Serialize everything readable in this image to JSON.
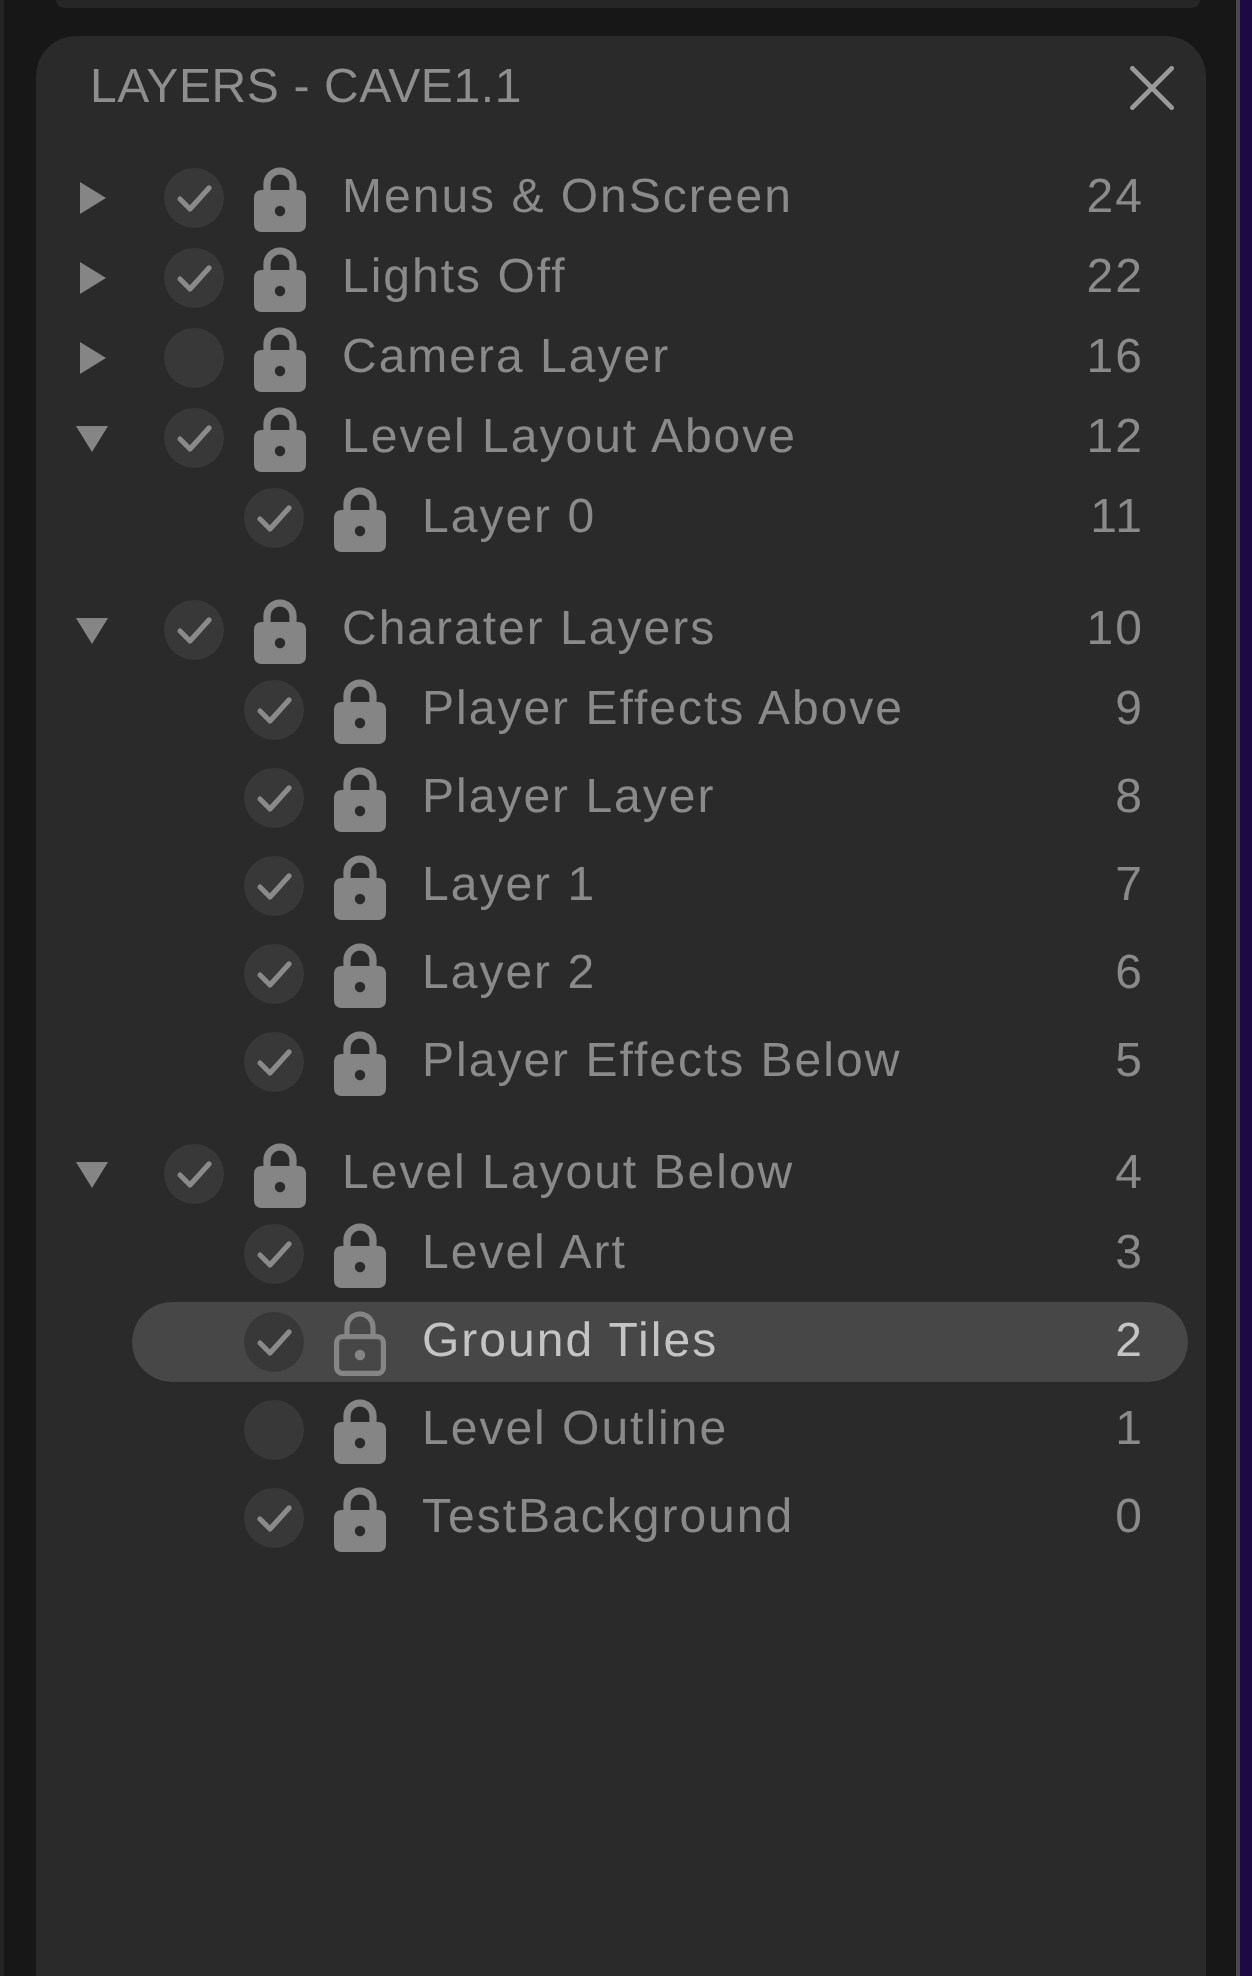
{
  "panel": {
    "title": "LAYERS - CAVE1.1"
  },
  "layers": [
    {
      "name": "Menus & OnScreen",
      "count": "24",
      "expanded": false,
      "visible": true,
      "locked": true,
      "selected": false
    },
    {
      "name": "Lights Off",
      "count": "22",
      "expanded": false,
      "visible": true,
      "locked": true,
      "selected": false
    },
    {
      "name": "Camera Layer",
      "count": "16",
      "expanded": false,
      "visible": false,
      "locked": true,
      "selected": false
    },
    {
      "name": "Level Layout Above",
      "count": "12",
      "expanded": true,
      "visible": true,
      "locked": true,
      "selected": false,
      "children": [
        {
          "name": "Layer 0",
          "count": "11",
          "visible": true,
          "locked": true,
          "selected": false
        }
      ]
    },
    {
      "name": "Charater Layers",
      "count": "10",
      "expanded": true,
      "visible": true,
      "locked": true,
      "selected": false,
      "children": [
        {
          "name": "Player Effects Above",
          "count": "9",
          "visible": true,
          "locked": true,
          "selected": false
        },
        {
          "name": "Player Layer",
          "count": "8",
          "visible": true,
          "locked": true,
          "selected": false
        },
        {
          "name": "Layer 1",
          "count": "7",
          "visible": true,
          "locked": true,
          "selected": false
        },
        {
          "name": "Layer 2",
          "count": "6",
          "visible": true,
          "locked": true,
          "selected": false
        },
        {
          "name": "Player Effects Below",
          "count": "5",
          "visible": true,
          "locked": true,
          "selected": false
        }
      ]
    },
    {
      "name": "Level Layout Below",
      "count": "4",
      "expanded": true,
      "visible": true,
      "locked": true,
      "selected": false,
      "children": [
        {
          "name": "Level Art",
          "count": "3",
          "visible": true,
          "locked": true,
          "selected": false
        },
        {
          "name": "Ground Tiles",
          "count": "2",
          "visible": true,
          "locked": false,
          "selected": true
        },
        {
          "name": "Level Outline",
          "count": "1",
          "visible": false,
          "locked": true,
          "selected": false
        },
        {
          "name": "TestBackground",
          "count": "0",
          "visible": true,
          "locked": true,
          "selected": false
        }
      ]
    }
  ]
}
